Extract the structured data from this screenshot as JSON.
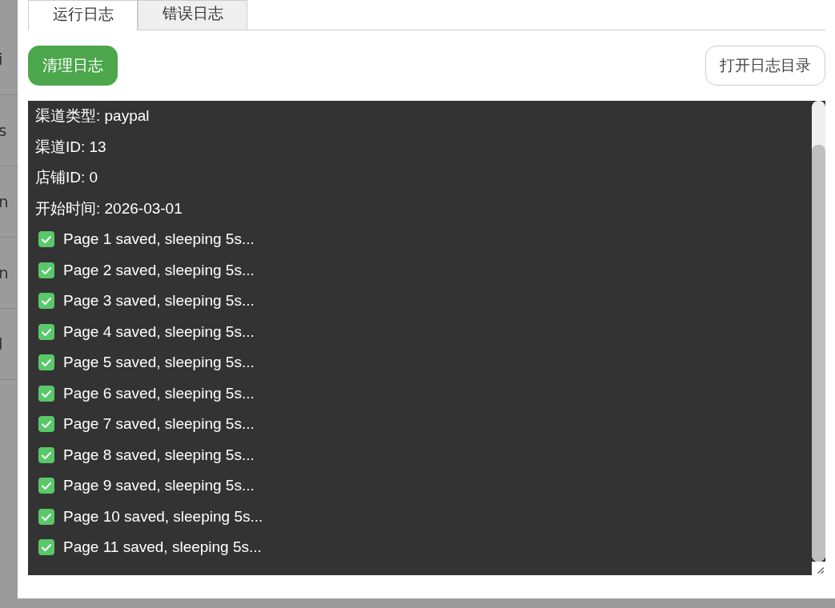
{
  "background_rows": [
    "i",
    "s",
    "n",
    "n",
    "l"
  ],
  "tabs": [
    {
      "label": "运行日志",
      "selected": true
    },
    {
      "label": "错误日志",
      "selected": false
    }
  ],
  "buttons": {
    "clear": "清理日志",
    "open_dir": "打开日志目录"
  },
  "log_lines": [
    {
      "kind": "text",
      "text": "渠道类型: paypal"
    },
    {
      "kind": "text",
      "text": "渠道ID: 13"
    },
    {
      "kind": "text",
      "text": "店铺ID: 0"
    },
    {
      "kind": "text",
      "text": "开始时间: 2026-03-01"
    },
    {
      "kind": "ok",
      "text": "Page 1 saved, sleeping 5s..."
    },
    {
      "kind": "ok",
      "text": "Page 2 saved, sleeping 5s..."
    },
    {
      "kind": "ok",
      "text": "Page 3 saved, sleeping 5s..."
    },
    {
      "kind": "ok",
      "text": "Page 4 saved, sleeping 5s..."
    },
    {
      "kind": "ok",
      "text": "Page 5 saved, sleeping 5s..."
    },
    {
      "kind": "ok",
      "text": "Page 6 saved, sleeping 5s..."
    },
    {
      "kind": "ok",
      "text": "Page 7 saved, sleeping 5s..."
    },
    {
      "kind": "ok",
      "text": "Page 8 saved, sleeping 5s..."
    },
    {
      "kind": "ok",
      "text": "Page 9 saved, sleeping 5s..."
    },
    {
      "kind": "ok",
      "text": "Page 10 saved, sleeping 5s..."
    },
    {
      "kind": "ok",
      "text": "Page 11 saved, sleeping 5s..."
    }
  ]
}
